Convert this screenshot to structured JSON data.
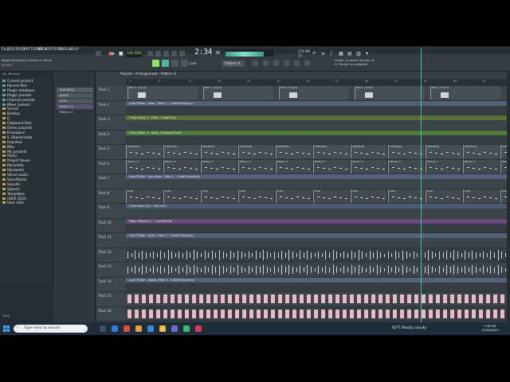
{
  "menu": {
    "items": [
      "FILE",
      "EDIT",
      "ADD",
      "PATTERNS",
      "VIEW",
      "OPTIONS",
      "TOOLS",
      "HELP"
    ]
  },
  "toolbar": {
    "tempo": "140.000",
    "time": "2:34",
    "time_sub": "36",
    "cpu_line1": "574 MB",
    "cpu_line2": "12",
    "pattern_selector": "Pattern 4",
    "line_mode": "Line",
    "news_line1": "Friday: A newer version of",
    "news_line2": "FL Studio is available!",
    "project_title": "[Beginn]Cloud(s) Fullness 12.06.flp",
    "project_time": "0:0:0.0"
  },
  "browser": {
    "header": "All...Browser",
    "items": [
      "Current project",
      "Recent files",
      "Plugin database",
      "Plugin presets",
      "Channel presets",
      "Mixer presets",
      "Scores",
      "Backup",
      "C:",
      "Clipboard files",
      "Demo projects",
      "Envelopes",
      "IL Shared data",
      "Impulses",
      "Misc",
      "My projects",
      "Packs",
      "Project bones",
      "Recorded",
      "Rendered",
      "Sliced audio",
      "Soundfonts",
      "Sounds",
      "Speech",
      "Templates",
      "USER 2024",
      "User data"
    ],
    "tags_label": "TAGS"
  },
  "picker": {
    "items": [
      "SUB BASS",
      "BASS2",
      "ACID",
      "Pattern 3",
      "Pattern 4"
    ]
  },
  "playlist": {
    "title": "Playlist - Arrangement - Pattern 4",
    "ruler": [
      "1",
      "9",
      "17",
      "25",
      "33",
      "41",
      "49",
      "57",
      "65",
      "73",
      "81",
      "89",
      "97"
    ],
    "tracks": [
      {
        "name": "Track 1"
      },
      {
        "name": "Track 2"
      },
      {
        "name": "Track 3"
      },
      {
        "name": "Track 4"
      },
      {
        "name": "Track 5"
      },
      {
        "name": "Track 6"
      },
      {
        "name": "Track 7"
      },
      {
        "name": "Track 8"
      },
      {
        "name": "Track 9"
      },
      {
        "name": "Track 10"
      },
      {
        "name": "Track 11"
      },
      {
        "name": "Track 12"
      },
      {
        "name": "Track 13"
      },
      {
        "name": "Track 14"
      },
      {
        "name": "Track 15"
      },
      {
        "name": "Track 16"
      }
    ],
    "automation": [
      "Love Philter - Bass - Filter 1 - Cutoff frequency",
      "Fruity Delay 3 - Filter - Cutoff freq",
      "Fruity Delay 3 - Wow - Feedback level",
      "Love Philter - Acid Bass - Filter 1 - Cutoff frequency",
      "Gross Beat (AC) - Mix level",
      "Magic Maestro 2 - Cutoff/Width",
      "Love Philter - ACID - Filter 1 - Cutoff frequency",
      "Love Philter - wood - Filter 1 - Cutoff frequency"
    ],
    "clip_labels": [
      "Pad 4 - Drums",
      "SUB BASS",
      "Pattern 3",
      "ACID"
    ]
  },
  "taskbar": {
    "search_placeholder": "Type here to search",
    "weather": "62°F  Mostly cloudy",
    "time": "7:48 PM",
    "date": "12/26/2023"
  }
}
